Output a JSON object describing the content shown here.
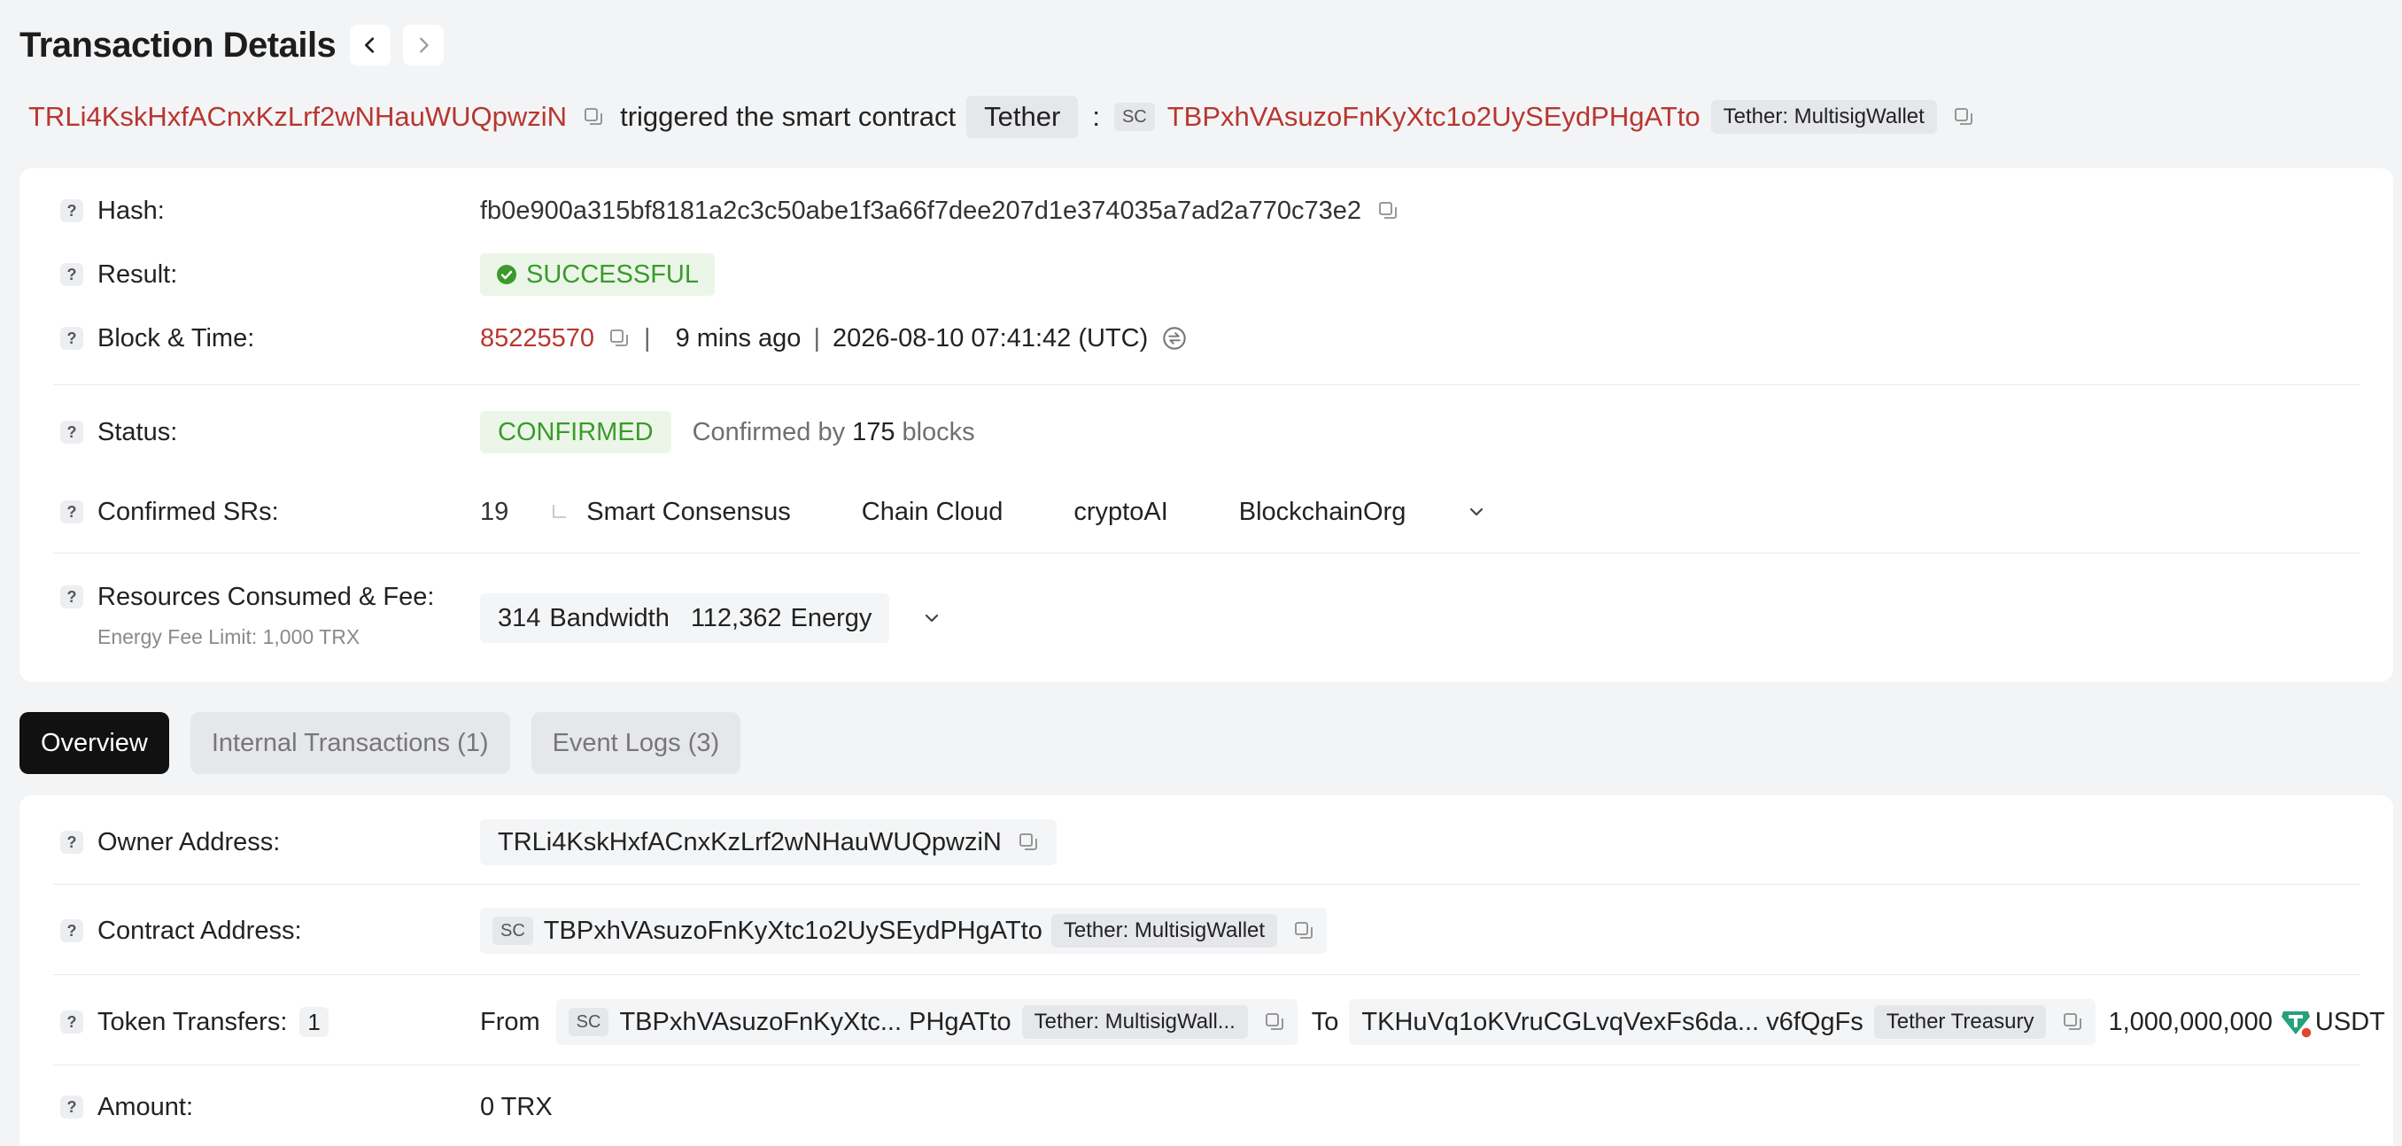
{
  "header": {
    "title": "Transaction Details"
  },
  "summary": {
    "owner": "TRLi4KskHxfACnxKzLrf2wNHauWUQpwziN",
    "action_text": "triggered the smart contract",
    "token_name": "Tether",
    "colon": ":",
    "sc_tag": "SC",
    "contract": "TBPxhVAsuzoFnKyXtc1o2UySEydPHgATto",
    "contract_tag": "Tether: MultisigWallet"
  },
  "details": {
    "hash_label": "Hash:",
    "hash": "fb0e900a315bf8181a2c3c50abe1f3a66f7dee207d1e374035a7ad2a770c73e2",
    "result_label": "Result:",
    "result": "SUCCESSFUL",
    "block_label": "Block & Time:",
    "block": "85225570",
    "sep": "|",
    "ago": "9 mins ago",
    "timestamp": "2026-08-10 07:41:42 (UTC)",
    "status_label": "Status:",
    "status": "CONFIRMED",
    "confirmed_by_prefix": "Confirmed by",
    "confirmed_blocks": "175",
    "confirmed_by_suffix": "blocks",
    "srs_label": "Confirmed SRs:",
    "srs_count": "19",
    "srs": [
      "Smart Consensus",
      "Chain Cloud",
      "cryptoAI",
      "BlockchainOrg"
    ],
    "resources_label": "Resources Consumed & Fee:",
    "fee_limit": "Energy Fee Limit: 1,000 TRX",
    "bandwidth_value": "314",
    "bandwidth_unit": "Bandwidth",
    "energy_value": "112,362",
    "energy_unit": "Energy"
  },
  "tabs": [
    {
      "label": "Overview",
      "active": true
    },
    {
      "label": "Internal Transactions (1)",
      "active": false
    },
    {
      "label": "Event Logs (3)",
      "active": false
    }
  ],
  "overview": {
    "owner_label": "Owner Address:",
    "owner": "TRLi4KskHxfACnxKzLrf2wNHauWUQpwziN",
    "contract_label": "Contract Address:",
    "sc_tag": "SC",
    "contract": "TBPxhVAsuzoFnKyXtc1o2UySEydPHgATto",
    "contract_tag": "Tether: MultisigWallet",
    "transfers_label": "Token Transfers:",
    "transfers_count": "1",
    "from_label": "From",
    "from_address": "TBPxhVAsuzoFnKyXtc... PHgATto",
    "from_tag": "Tether: MultisigWall...",
    "to_label": "To",
    "to_address": "TKHuVq1oKVruCGLvqVexFs6da... v6fQgFs",
    "to_tag": "Tether Treasury",
    "amount_transferred": "1,000,000,000",
    "token_symbol": "USDT",
    "amount_label": "Amount:",
    "amount": "0 TRX"
  },
  "colors": {
    "link_red": "#b8362f",
    "success_green": "#3a9b2c",
    "tether_green": "#26a17b"
  },
  "icons": [
    "chevron-left-icon",
    "chevron-right-icon",
    "copy-icon",
    "question-icon",
    "check-circle-icon",
    "refresh-icon",
    "chevron-down-icon",
    "tether-icon"
  ]
}
